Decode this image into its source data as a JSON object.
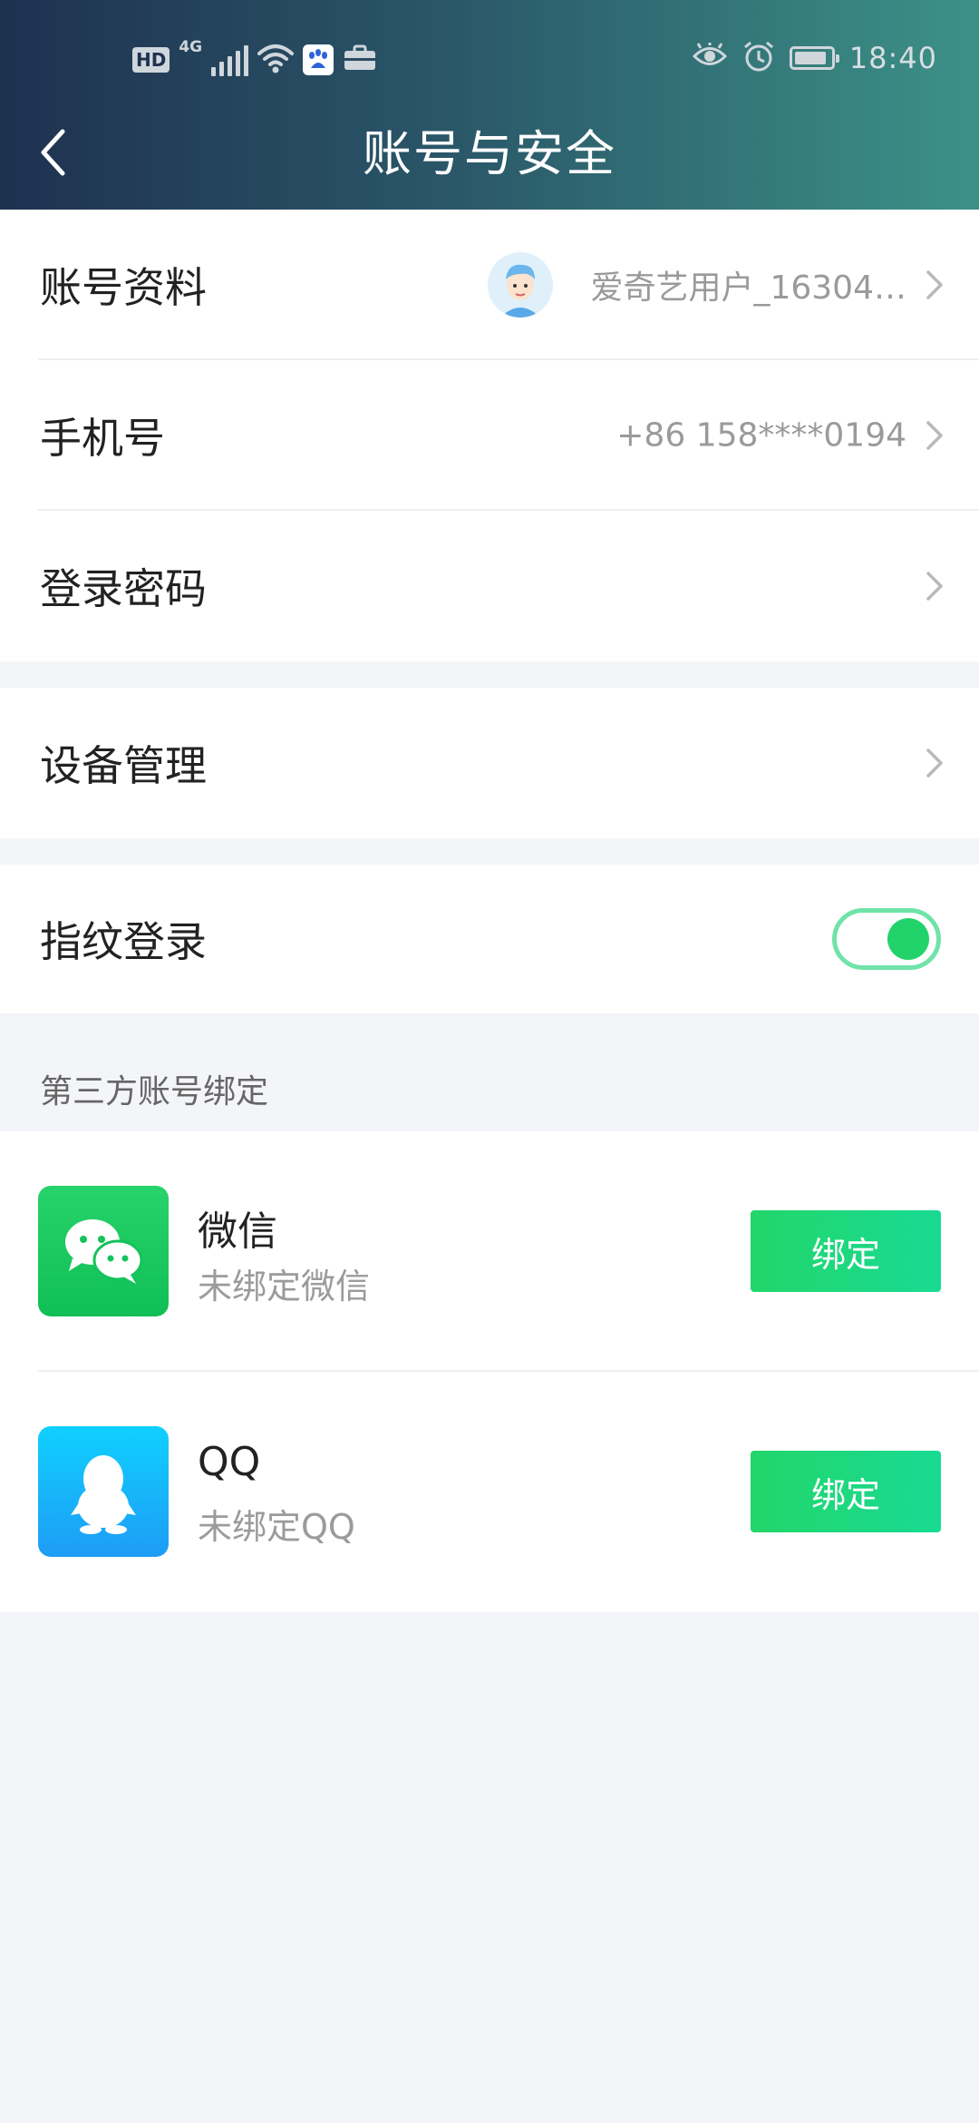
{
  "status_bar": {
    "hd_label": "HD",
    "network_label": "4G",
    "time": "18:40"
  },
  "header": {
    "title": "账号与安全"
  },
  "account_group": {
    "profile": {
      "label": "账号资料",
      "value": "爱奇艺用户_16304…"
    },
    "phone": {
      "label": "手机号",
      "value": "+86 158****0194"
    },
    "password": {
      "label": "登录密码"
    }
  },
  "device_group": {
    "devices": {
      "label": "设备管理"
    }
  },
  "fingerprint_group": {
    "fingerprint": {
      "label": "指纹登录",
      "enabled": true
    }
  },
  "third_party": {
    "section_title": "第三方账号绑定",
    "items": [
      {
        "name": "微信",
        "status": "未绑定微信",
        "button": "绑定",
        "icon": "wechat-icon",
        "color": "#1dc35b"
      },
      {
        "name": "QQ",
        "status": "未绑定QQ",
        "button": "绑定",
        "icon": "qq-icon",
        "color": "#15b5f5"
      }
    ]
  },
  "colors": {
    "accent_green": "#22d36b",
    "header_start": "#1e3150",
    "header_end": "#3c9187"
  }
}
